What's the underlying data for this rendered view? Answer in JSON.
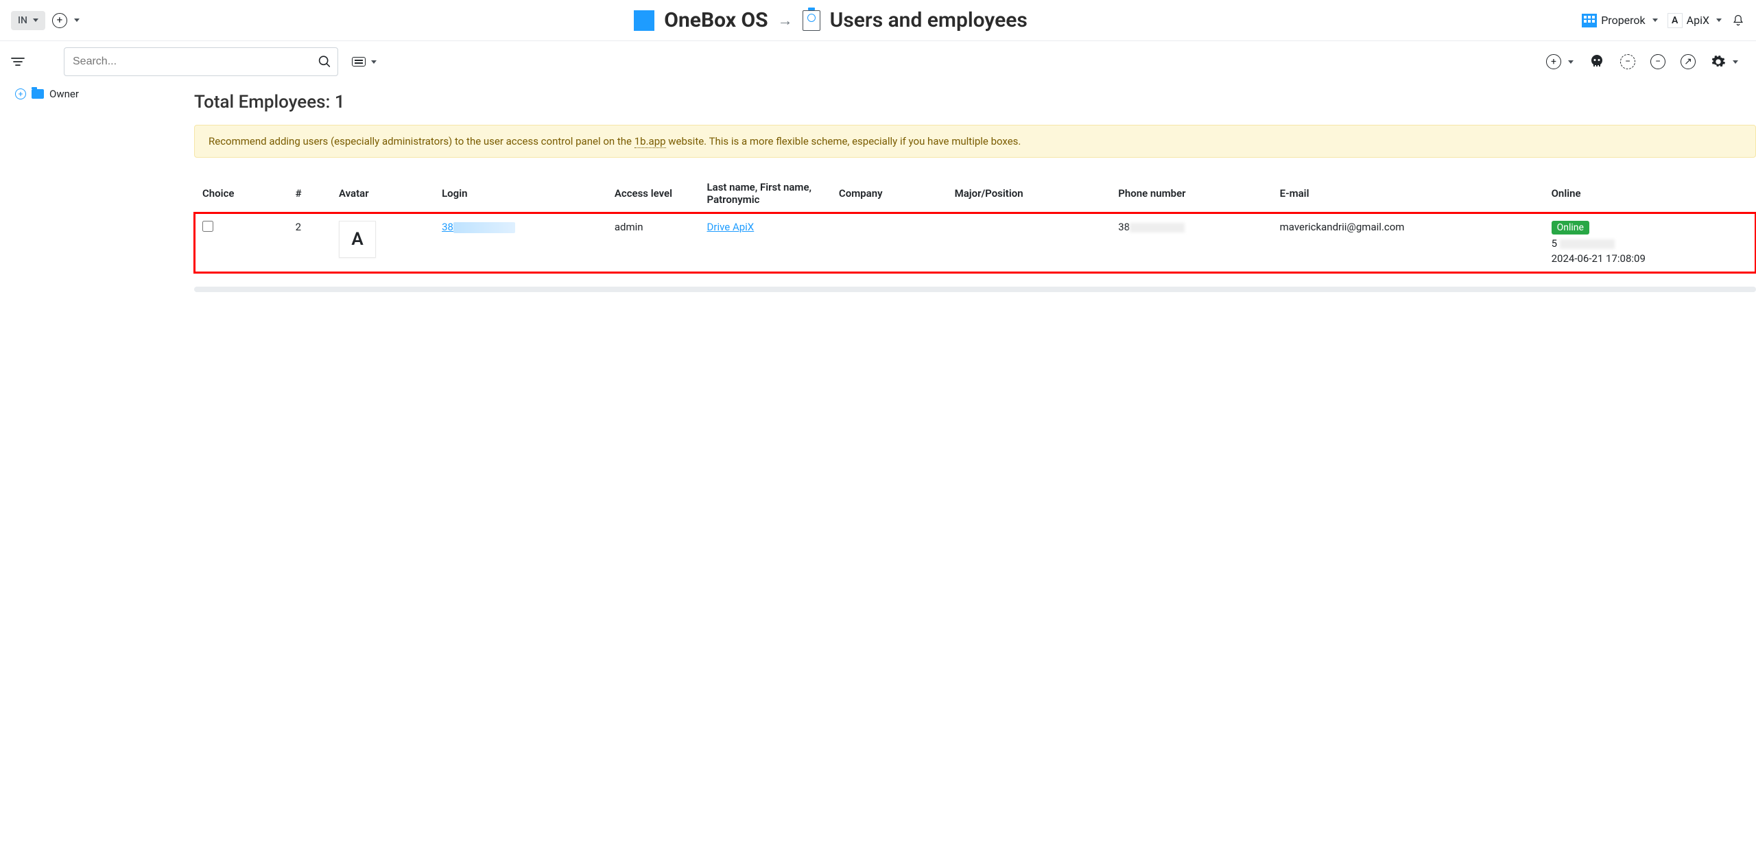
{
  "topbar": {
    "lang": "IN",
    "brand": "OneBox OS",
    "page_title": "Users and employees",
    "org_name": "Properok",
    "user_name": "ApiX",
    "user_avatar_letter": "A"
  },
  "subbar": {
    "search_placeholder": "Search..."
  },
  "sidebar": {
    "root_label": "Owner"
  },
  "main": {
    "total_label": "Total Employees: 1",
    "banner_prefix": "Recommend adding users (especially administrators) to the user access control panel on the ",
    "banner_link": "1b.app",
    "banner_suffix": " website. This is a more flexible scheme, especially if you have multiple boxes."
  },
  "table": {
    "headers": {
      "choice": "Choice",
      "num": "#",
      "avatar": "Avatar",
      "login": "Login",
      "access": "Access level",
      "name": "Last name, First name, Patronymic",
      "company": "Company",
      "position": "Major/Position",
      "phone": "Phone number",
      "email": "E-mail",
      "online": "Online"
    },
    "rows": [
      {
        "num": "2",
        "avatar_letter": "A",
        "login_prefix": "38",
        "access": "admin",
        "name": "Drive ApiX",
        "company": "",
        "position": "",
        "phone_prefix": "38",
        "email": "maverickandrii@gmail.com",
        "online_badge": "Online",
        "online_line2_prefix": "5",
        "online_timestamp": "2024-06-21 17:08:09"
      }
    ]
  }
}
